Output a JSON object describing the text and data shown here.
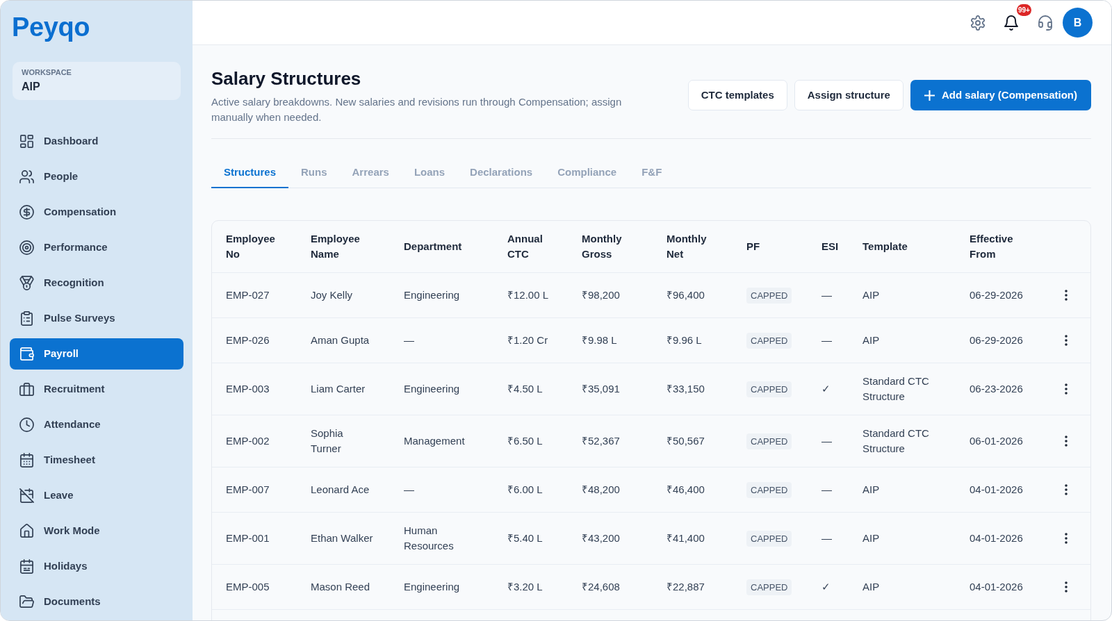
{
  "sidebar": {
    "logo": "Peyqo",
    "workspace": {
      "label": "WORKSPACE",
      "name": "AIP"
    },
    "items": [
      {
        "label": "Dashboard",
        "selected": false
      },
      {
        "label": "People",
        "selected": false
      },
      {
        "label": "Compensation",
        "selected": false
      },
      {
        "label": "Performance",
        "selected": false
      },
      {
        "label": "Recognition",
        "selected": false
      },
      {
        "label": "Pulse Surveys",
        "selected": false
      },
      {
        "label": "Payroll",
        "selected": true
      },
      {
        "label": "Recruitment",
        "selected": false
      },
      {
        "label": "Attendance",
        "selected": false
      },
      {
        "label": "Timesheet",
        "selected": false
      },
      {
        "label": "Leave",
        "selected": false
      },
      {
        "label": "Work Mode",
        "selected": false
      },
      {
        "label": "Holidays",
        "selected": false
      },
      {
        "label": "Documents",
        "selected": false
      }
    ]
  },
  "header": {
    "notification_badge": "99+",
    "avatar": "B"
  },
  "page": {
    "title": "Salary Structures",
    "subtitle": "Active salary breakdowns. New salaries and revisions run through Compensation; assign manually when needed.",
    "buttons": [
      {
        "label": "CTC templates",
        "kind": "secondary"
      },
      {
        "label": "Assign structure",
        "kind": "secondary"
      },
      {
        "label": "Add salary (Compensation)",
        "kind": "primary"
      }
    ]
  },
  "tabs": [
    {
      "label": "Structures",
      "selected": true
    },
    {
      "label": "Runs",
      "selected": false
    },
    {
      "label": "Arrears",
      "selected": false
    },
    {
      "label": "Loans",
      "selected": false
    },
    {
      "label": "Declarations",
      "selected": false
    },
    {
      "label": "Compliance",
      "selected": false
    },
    {
      "label": "F&F",
      "selected": false
    }
  ],
  "table": {
    "columns": [
      {
        "label": "Employee No",
        "kind": "text"
      },
      {
        "label": "Employee Name",
        "kind": "text"
      },
      {
        "label": "Department",
        "kind": "text"
      },
      {
        "label": "Annual CTC",
        "kind": "text"
      },
      {
        "label": "Monthly Gross",
        "kind": "text"
      },
      {
        "label": "Monthly Net",
        "kind": "text"
      },
      {
        "label": "PF",
        "kind": "badge"
      },
      {
        "label": "ESI",
        "kind": "text"
      },
      {
        "label": "Template",
        "kind": "text"
      },
      {
        "label": "Effective From",
        "kind": "text"
      }
    ],
    "rows": [
      [
        "EMP-027",
        "Joy Kelly",
        "Engineering",
        "₹12.00 L",
        "₹98,200",
        "₹96,400",
        "CAPPED",
        "—",
        "AIP",
        "06-29-2026"
      ],
      [
        "EMP-026",
        "Aman Gupta",
        "—",
        "₹1.20 Cr",
        "₹9.98 L",
        "₹9.96 L",
        "CAPPED",
        "—",
        "AIP",
        "06-29-2026"
      ],
      [
        "EMP-003",
        "Liam Carter",
        "Engineering",
        "₹4.50 L",
        "₹35,091",
        "₹33,150",
        "CAPPED",
        "✓",
        "Standard CTC Structure",
        "06-23-2026"
      ],
      [
        "EMP-002",
        "Sophia Turner",
        "Management",
        "₹6.50 L",
        "₹52,367",
        "₹50,567",
        "CAPPED",
        "—",
        "Standard CTC Structure",
        "06-01-2026"
      ],
      [
        "EMP-007",
        "Leonard Ace",
        "—",
        "₹6.00 L",
        "₹48,200",
        "₹46,400",
        "CAPPED",
        "—",
        "AIP",
        "04-01-2026"
      ],
      [
        "EMP-001",
        "Ethan Walker",
        "Human Resources",
        "₹5.40 L",
        "₹43,200",
        "₹41,400",
        "CAPPED",
        "—",
        "AIP",
        "04-01-2026"
      ],
      [
        "EMP-005",
        "Mason Reed",
        "Engineering",
        "₹3.20 L",
        "₹24,608",
        "₹22,887",
        "CAPPED",
        "✓",
        "AIP",
        "04-01-2026"
      ]
    ]
  }
}
